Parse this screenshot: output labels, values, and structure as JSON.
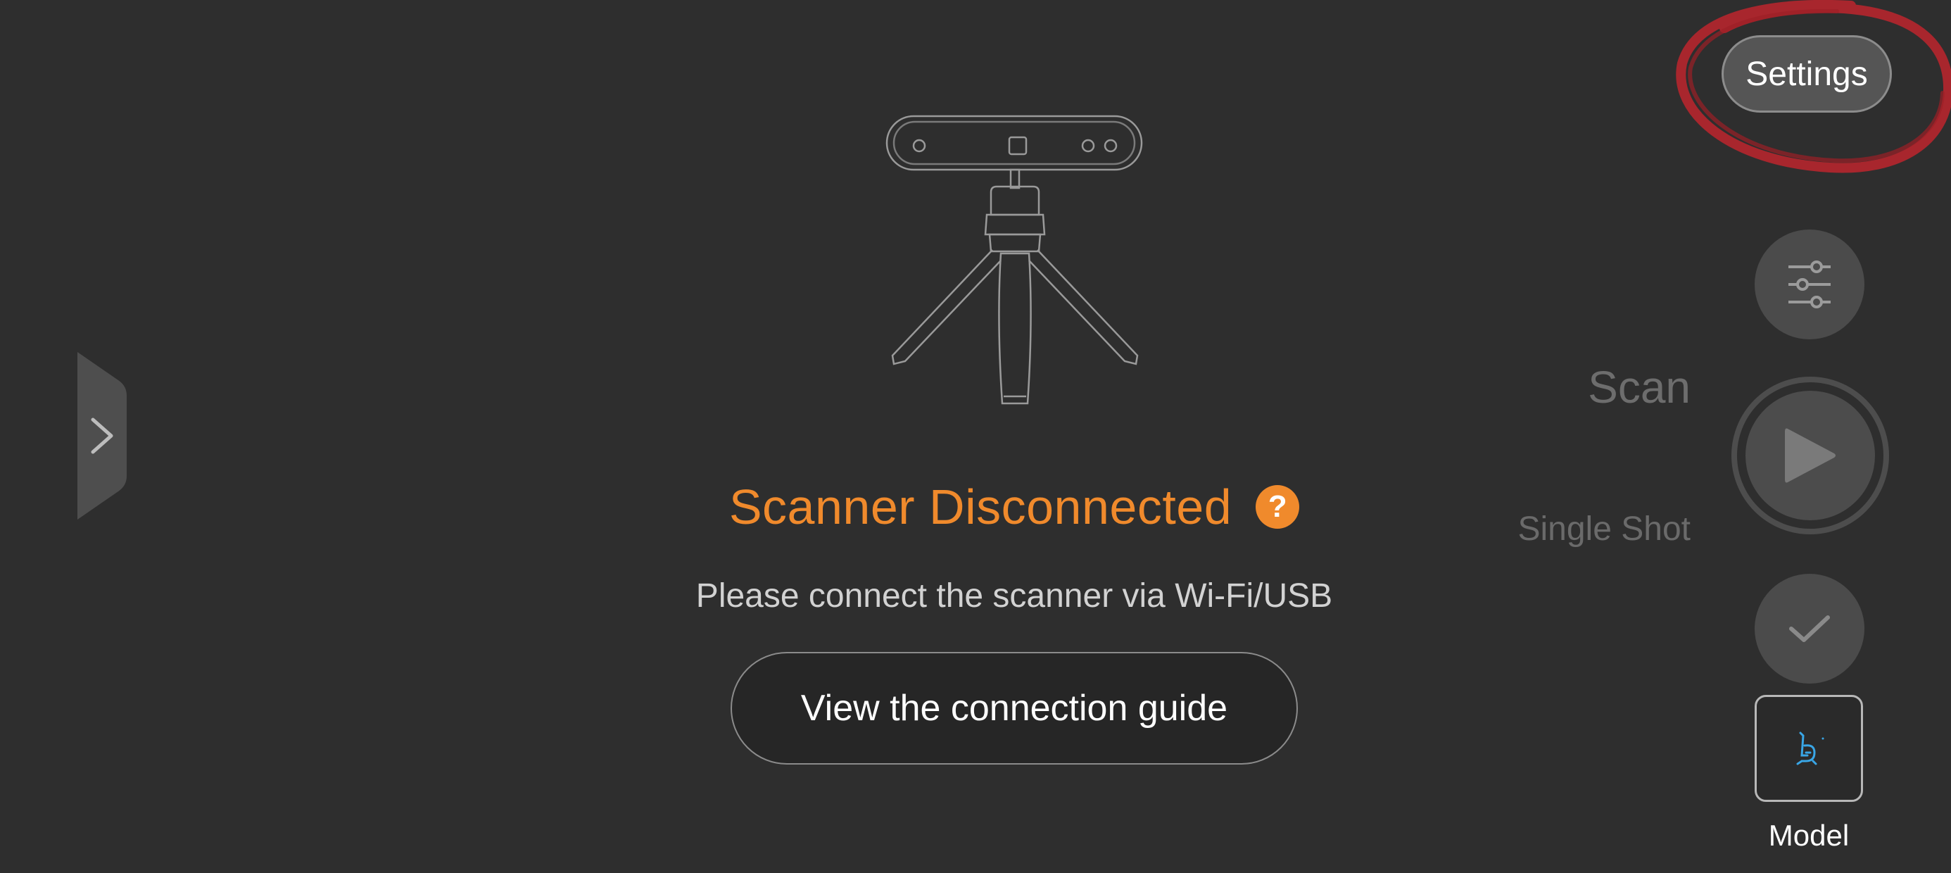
{
  "status": {
    "title": "Scanner Disconnected",
    "help_icon": "?",
    "subtitle": "Please connect the scanner via Wi-Fi/USB",
    "guide_button_label": "View the connection guide"
  },
  "controls": {
    "settings_label": "Settings",
    "modes": [
      {
        "label": "Scan",
        "active": false
      },
      {
        "label": "Single Shot",
        "active": false
      }
    ],
    "model_label": "Model"
  },
  "icons": {
    "drawer": "chevron-right-icon",
    "adjust": "sliders-icon",
    "scan": "play-icon",
    "confirm": "check-icon",
    "model": "model-thumbnail"
  },
  "colors": {
    "background": "#2e2e2e",
    "accent": "#f08a2c",
    "annotation": "#b3262e",
    "model_thumbnail": "#39a6e6"
  }
}
